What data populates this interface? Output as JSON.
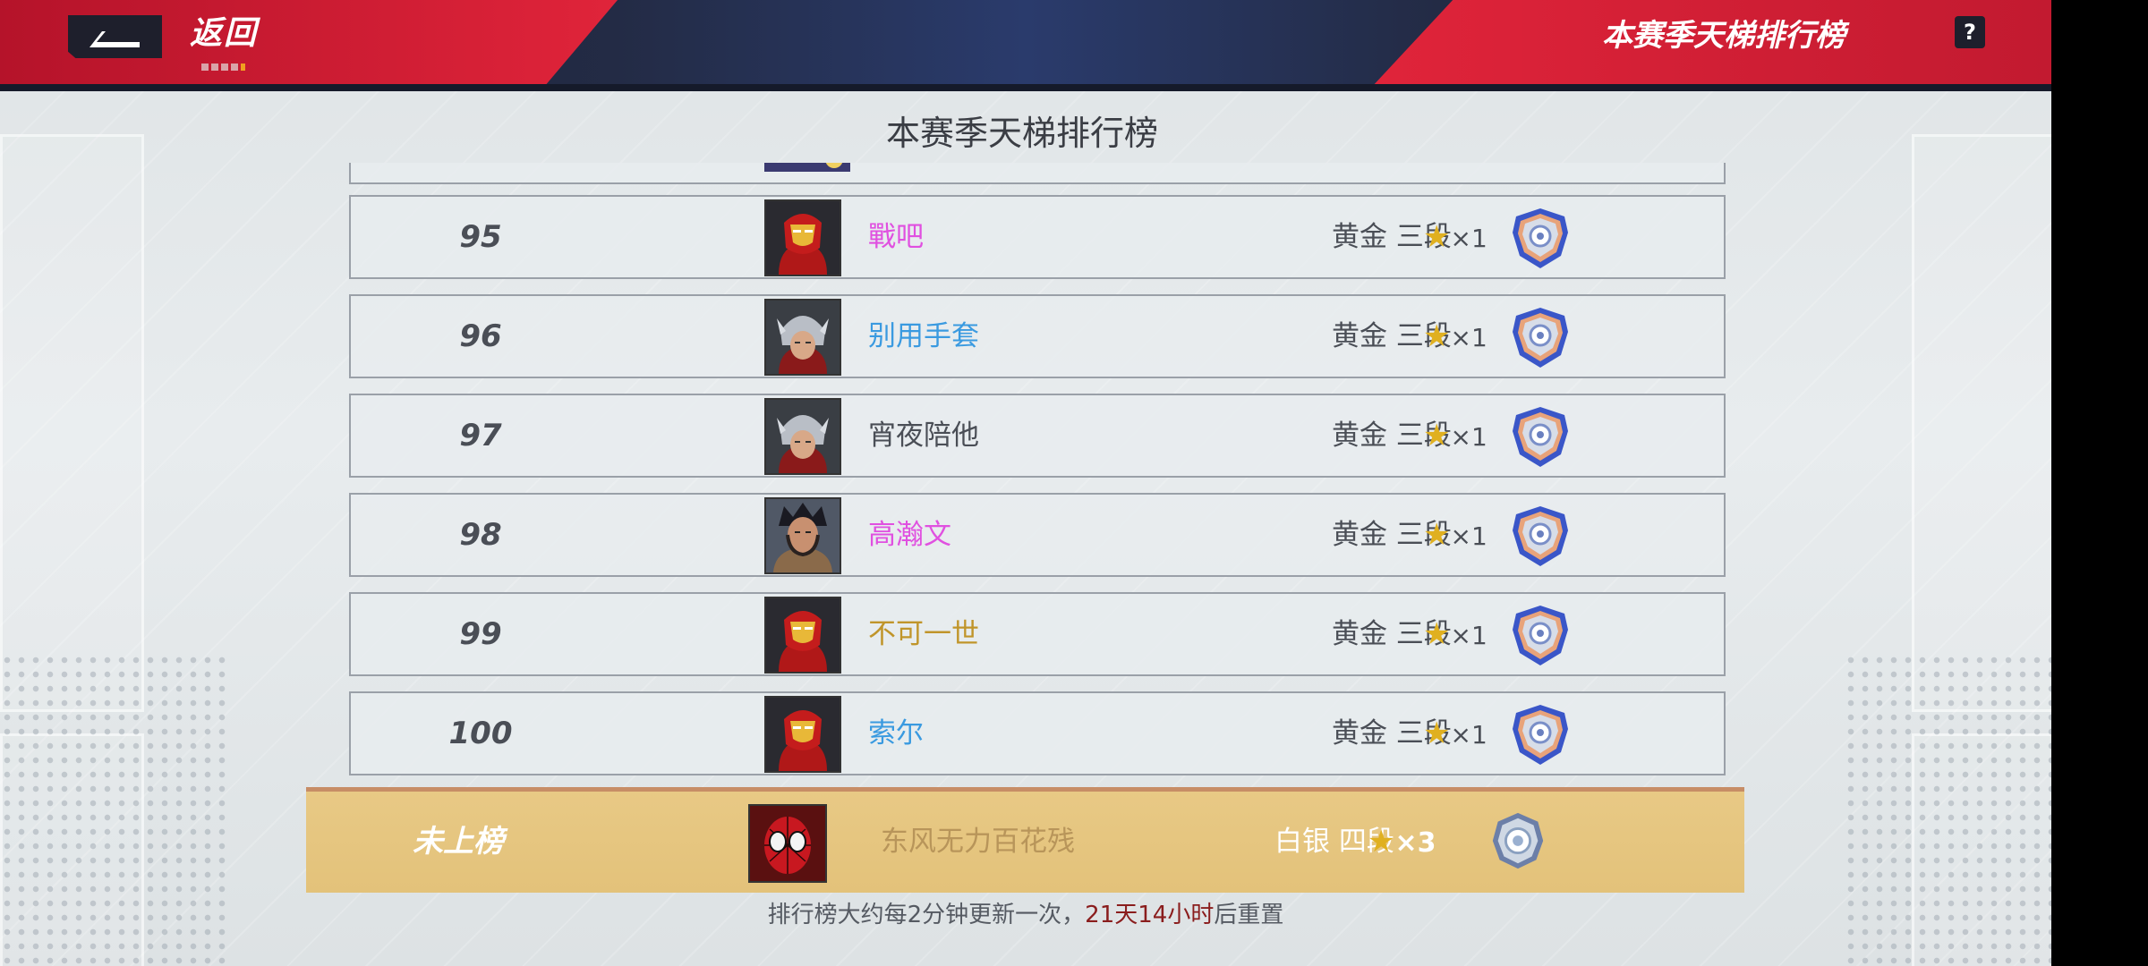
{
  "header": {
    "back_label": "返回",
    "title": "本赛季天梯排行榜",
    "help_label": "?"
  },
  "board": {
    "title": "本赛季天梯排行榜",
    "rows": [
      {
        "rank": "95",
        "name": "戰吧",
        "name_color": "#e050e0",
        "tier": "黄金 三段",
        "stars": "×1",
        "avatar": "iron-man"
      },
      {
        "rank": "96",
        "name": "别用手套",
        "name_color": "#3a9ae0",
        "tier": "黄金 三段",
        "stars": "×1",
        "avatar": "thor"
      },
      {
        "rank": "97",
        "name": "宵夜陪他",
        "name_color": "#4a4e56",
        "tier": "黄金 三段",
        "stars": "×1",
        "avatar": "thor"
      },
      {
        "rank": "98",
        "name": "高瀚文",
        "name_color": "#e050e0",
        "tier": "黄金 三段",
        "stars": "×1",
        "avatar": "wolverine"
      },
      {
        "rank": "99",
        "name": "不可一世",
        "name_color": "#c0952a",
        "tier": "黄金 三段",
        "stars": "×1",
        "avatar": "iron-man"
      },
      {
        "rank": "100",
        "name": "索尔",
        "name_color": "#3a9ae0",
        "tier": "黄金 三段",
        "stars": "×1",
        "avatar": "iron-man"
      }
    ]
  },
  "my_entry": {
    "rank": "未上榜",
    "name": "东风无力百花残",
    "tier": "白银 四段",
    "stars": "×3",
    "avatar": "spider-man"
  },
  "footer": {
    "prefix": "排行榜大约每2分钟更新一次，",
    "highlight": "21天14小时",
    "suffix": "后重置"
  },
  "colors": {
    "header_red": "#e0243a",
    "highlight_row": "#e6c47f",
    "reset_time": "#8a1d1d"
  }
}
